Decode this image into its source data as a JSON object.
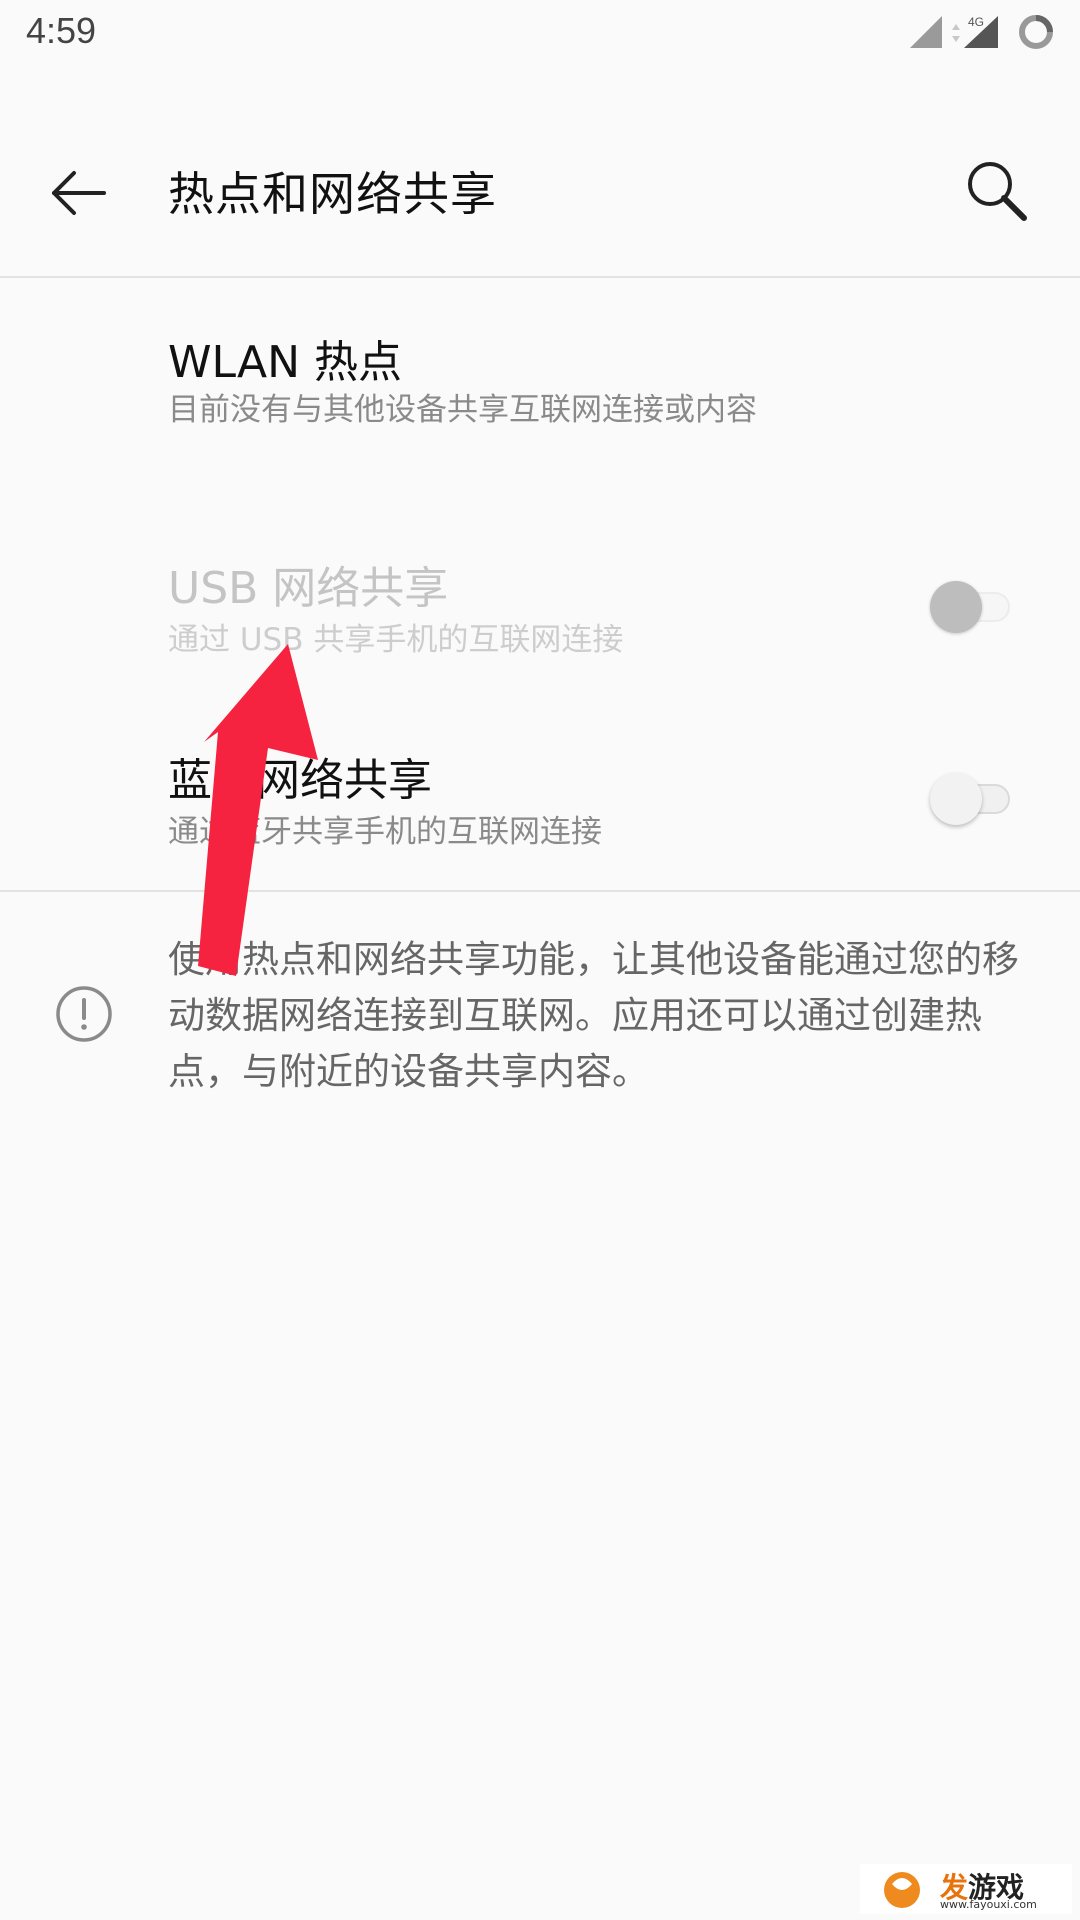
{
  "status_bar": {
    "time": "4:59",
    "network_label": "4G"
  },
  "app_bar": {
    "title": "热点和网络共享",
    "back_icon": "arrow-left-icon",
    "search_icon": "search-icon"
  },
  "items": [
    {
      "title": "WLAN 热点",
      "subtitle": "目前没有与其他设备共享互联网连接或内容",
      "enabled": true
    },
    {
      "title": "USB 网络共享",
      "subtitle": "通过 USB 共享手机的互联网连接",
      "enabled": false,
      "toggle_on": false
    },
    {
      "title": "蓝牙网络共享",
      "subtitle": "通过蓝牙共享手机的互联网连接",
      "enabled": true,
      "toggle_on": false
    }
  ],
  "info": {
    "icon": "info-icon",
    "text": "使用热点和网络共享功能，让其他设备能通过您的移动数据网络连接到互联网。应用还可以通过创建热点，与附近的设备共享内容。"
  },
  "overlay": {
    "arrow_color": "#f5233f"
  },
  "watermark": {
    "brand_accent": "发",
    "brand_rest": "游戏",
    "url": "www.fayouxi.com"
  },
  "colors": {
    "background": "#fafafa",
    "divider": "#e2e2e2",
    "arrow": "#f5233f"
  }
}
